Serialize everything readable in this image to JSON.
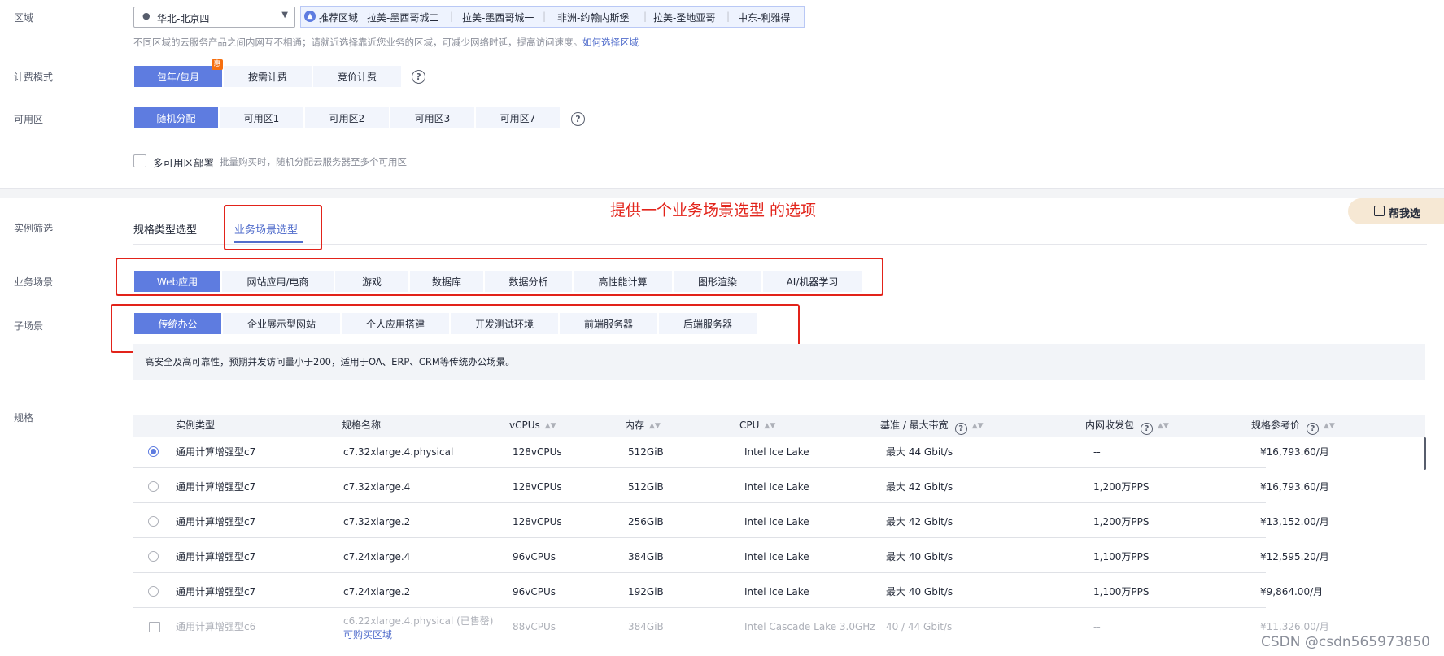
{
  "region": {
    "label": "区域",
    "selected": "华北-北京四",
    "recommend_label": "推荐区域",
    "recommended": [
      "拉美-墨西哥城二",
      "拉美-墨西哥城一",
      "非洲-约翰内斯堡",
      "拉美-圣地亚哥",
      "中东-利雅得"
    ],
    "hint": "不同区域的云服务产品之间内网互不相通；请就近选择靠近您业务的区域，可减少网络时延，提高访问速度。",
    "hint_link": "如何选择区域"
  },
  "billing": {
    "label": "计费模式",
    "options": [
      "包年/包月",
      "按需计费",
      "竞价计费"
    ],
    "selected_index": 0,
    "badge": "惠"
  },
  "az": {
    "label": "可用区",
    "options": [
      "随机分配",
      "可用区1",
      "可用区2",
      "可用区3",
      "可用区7"
    ],
    "selected_index": 0,
    "multi_az_label": "多可用区部署",
    "multi_az_hint": "批量购买时，随机分配云服务器至多个可用区"
  },
  "filter": {
    "label": "实例筛选",
    "tabs": [
      "规格类型选型",
      "业务场景选型"
    ],
    "active_tab": 1,
    "help_button": "帮我选"
  },
  "annotation": "提供一个业务场景选型 的选项",
  "scenario": {
    "label": "业务场景",
    "options": [
      "Web应用",
      "网站应用/电商",
      "游戏",
      "数据库",
      "数据分析",
      "高性能计算",
      "图形渲染",
      "AI/机器学习"
    ],
    "selected_index": 0
  },
  "subscenario": {
    "label": "子场景",
    "options": [
      "传统办公",
      "企业展示型网站",
      "个人应用搭建",
      "开发测试环境",
      "前端服务器",
      "后端服务器"
    ],
    "selected_index": 0,
    "description": "高安全及高可靠性，预期并发访问量小于200，适用于OA、ERP、CRM等传统办公场景。"
  },
  "spec": {
    "label": "规格",
    "columns": [
      "实例类型",
      "规格名称",
      "vCPUs",
      "内存",
      "CPU",
      "基准 / 最大带宽",
      "内网收发包",
      "规格参考价"
    ],
    "rows": [
      {
        "type": "通用计算增强型c7",
        "name": "c7.32xlarge.4.physical",
        "vcpus": "128vCPUs",
        "mem": "512GiB",
        "cpu": "Intel Ice Lake",
        "bw": "最大 44 Gbit/s",
        "pps": "--",
        "price": "¥16,793.60/月"
      },
      {
        "type": "通用计算增强型c7",
        "name": "c7.32xlarge.4",
        "vcpus": "128vCPUs",
        "mem": "512GiB",
        "cpu": "Intel Ice Lake",
        "bw": "最大 42 Gbit/s",
        "pps": "1,200万PPS",
        "price": "¥16,793.60/月"
      },
      {
        "type": "通用计算增强型c7",
        "name": "c7.32xlarge.2",
        "vcpus": "128vCPUs",
        "mem": "256GiB",
        "cpu": "Intel Ice Lake",
        "bw": "最大 42 Gbit/s",
        "pps": "1,200万PPS",
        "price": "¥13,152.00/月"
      },
      {
        "type": "通用计算增强型c7",
        "name": "c7.24xlarge.4",
        "vcpus": "96vCPUs",
        "mem": "384GiB",
        "cpu": "Intel Ice Lake",
        "bw": "最大 40 Gbit/s",
        "pps": "1,100万PPS",
        "price": "¥12,595.20/月"
      },
      {
        "type": "通用计算增强型c7",
        "name": "c7.24xlarge.2",
        "vcpus": "96vCPUs",
        "mem": "192GiB",
        "cpu": "Intel Ice Lake",
        "bw": "最大 40 Gbit/s",
        "pps": "1,100万PPS",
        "price": "¥9,864.00/月"
      },
      {
        "type": "通用计算增强型c6",
        "name": "c6.22xlarge.4.physical (已售罄)",
        "buy_link": "可购买区域",
        "vcpus": "88vCPUs",
        "mem": "384GiB",
        "cpu": "Intel Cascade Lake 3.0GHz",
        "bw": "40 / 44 Gbit/s",
        "pps": "--",
        "price": "¥11,326.00/月"
      }
    ],
    "selected_index": 0
  },
  "watermark": "CSDN @csdn565973850"
}
